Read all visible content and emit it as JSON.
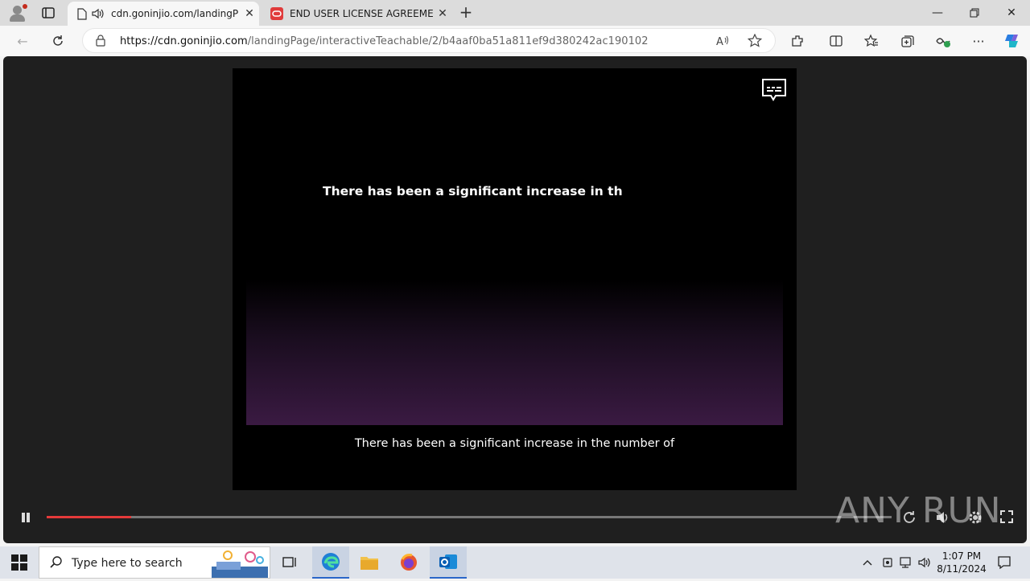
{
  "browser": {
    "tabs": [
      {
        "label": "cdn.goninjio.com/landingP",
        "active": true
      },
      {
        "label": "END USER LICENSE AGREEMENT",
        "active": false
      }
    ],
    "url_host": "https://cdn.goninjio.com",
    "url_path": "/landingPage/interactiveTeachable/2/b4aaf0ba51a811ef9d380242ac190102"
  },
  "video": {
    "headline": "There has been a significant increase in th",
    "caption": "There has been a significant increase in the number of",
    "progress": 0.1
  },
  "watermark": "ANY  RUN",
  "taskbar": {
    "search_placeholder": "Type here to search",
    "time": "1:07 PM",
    "date": "8/11/2024"
  },
  "colors": {
    "accent": "#e43a3a",
    "video_gradient_end": "#3a1a42"
  }
}
